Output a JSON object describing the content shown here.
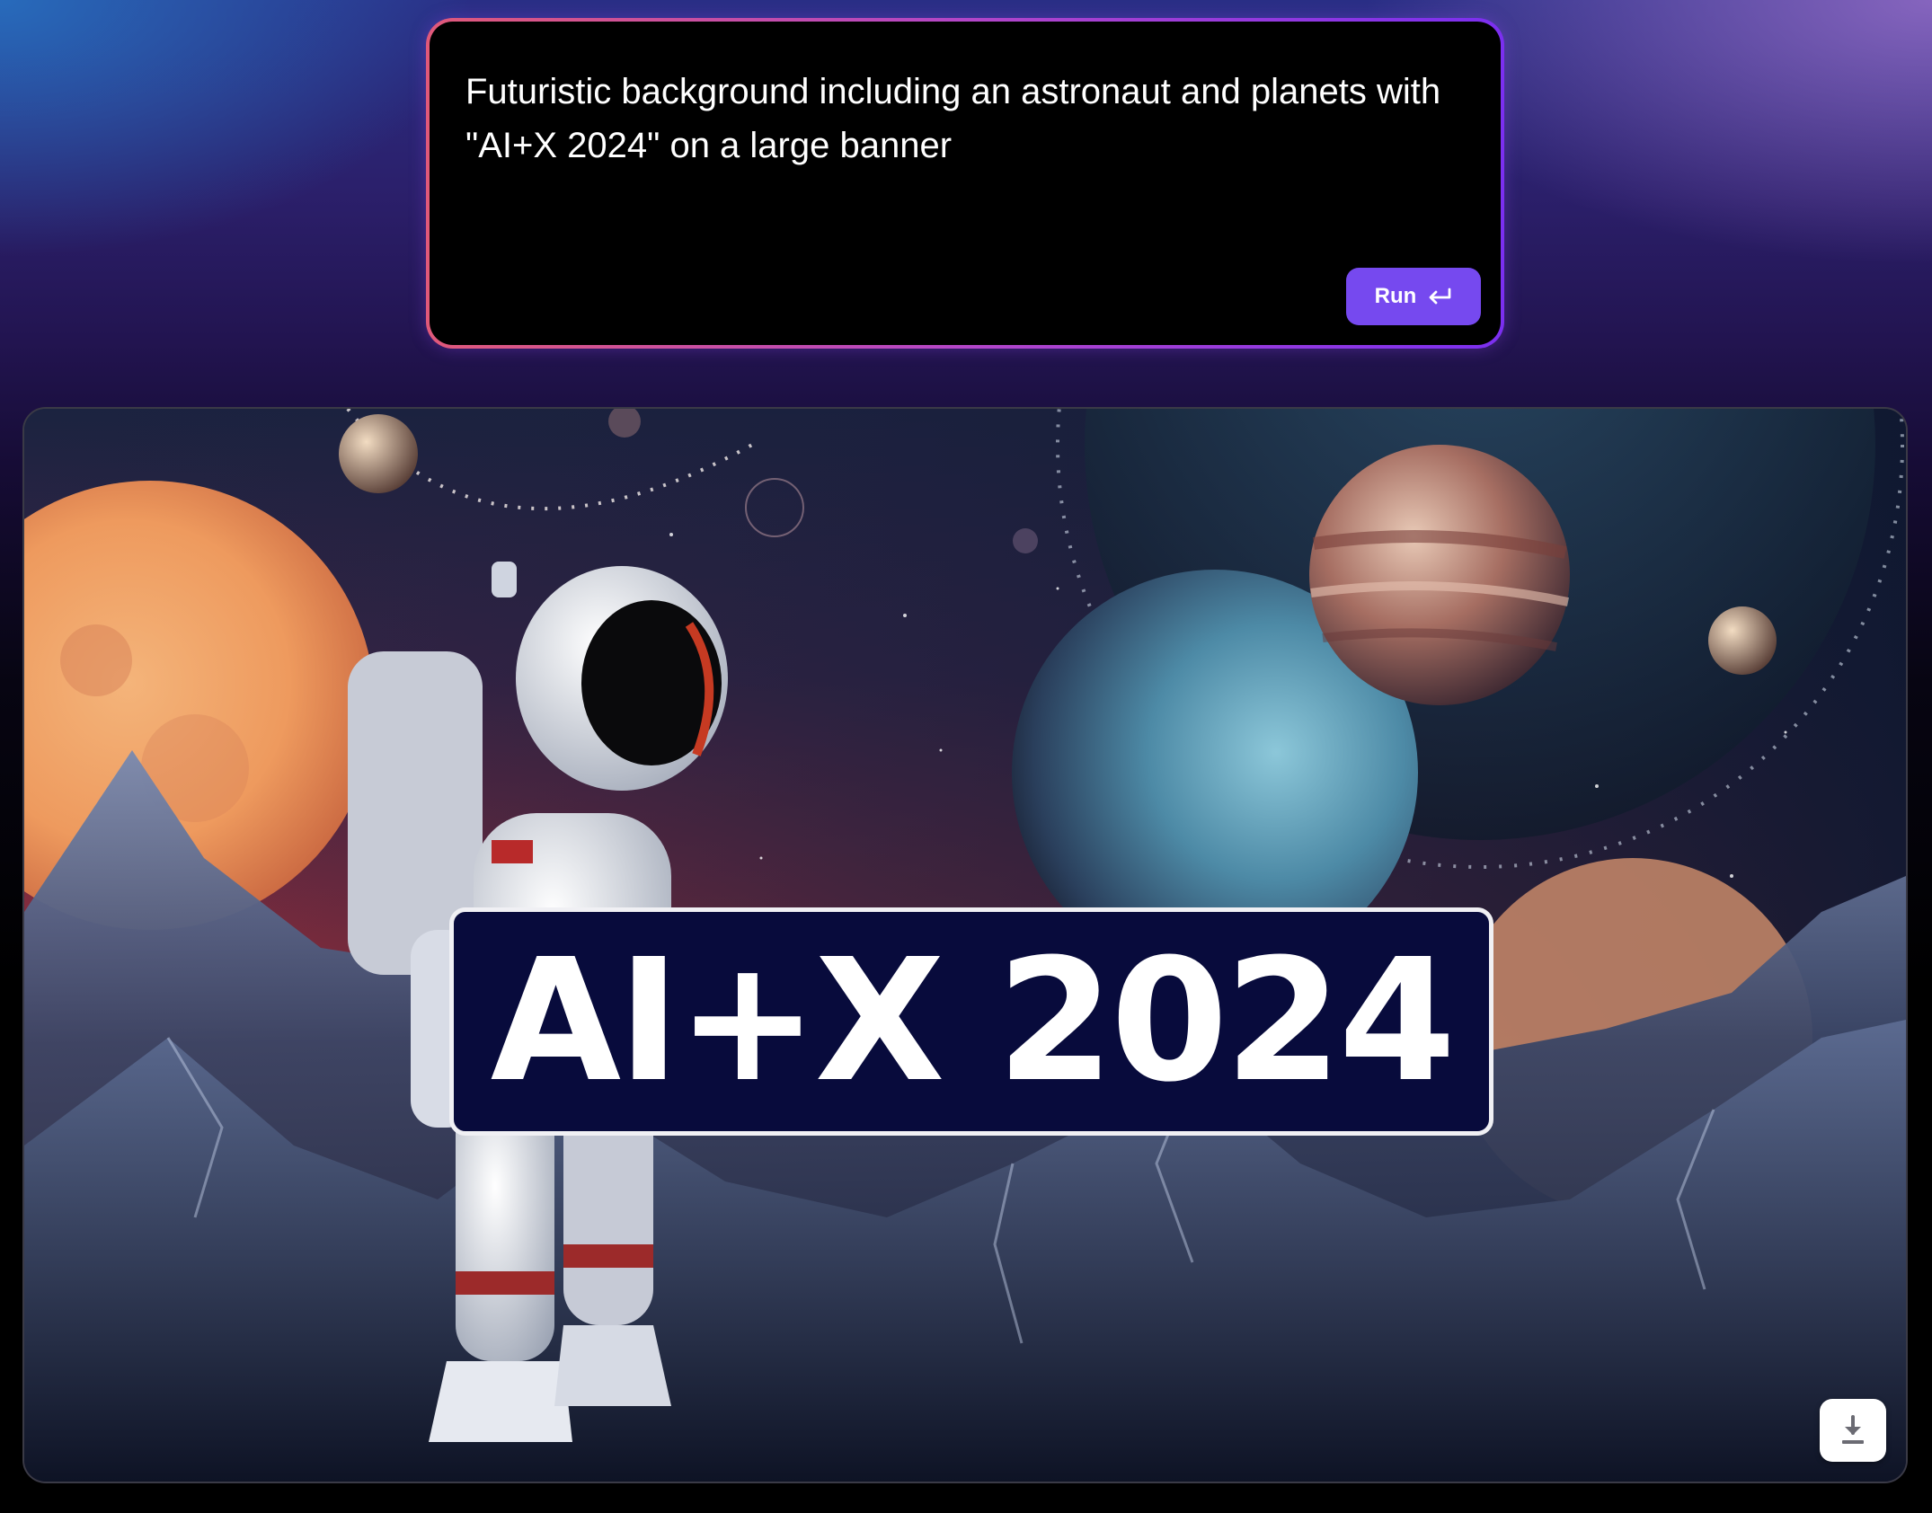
{
  "prompt": {
    "text": "Futuristic background including an astronaut and planets with \"AI+X 2024\" on a large banner",
    "run_label": "Run",
    "run_icon": "return-arrow-icon"
  },
  "generated_image": {
    "banner_text": "AI+X 2024",
    "download_icon": "download-icon"
  },
  "colors": {
    "accent": "#7649ef",
    "banner_bg": "#080b3c"
  }
}
